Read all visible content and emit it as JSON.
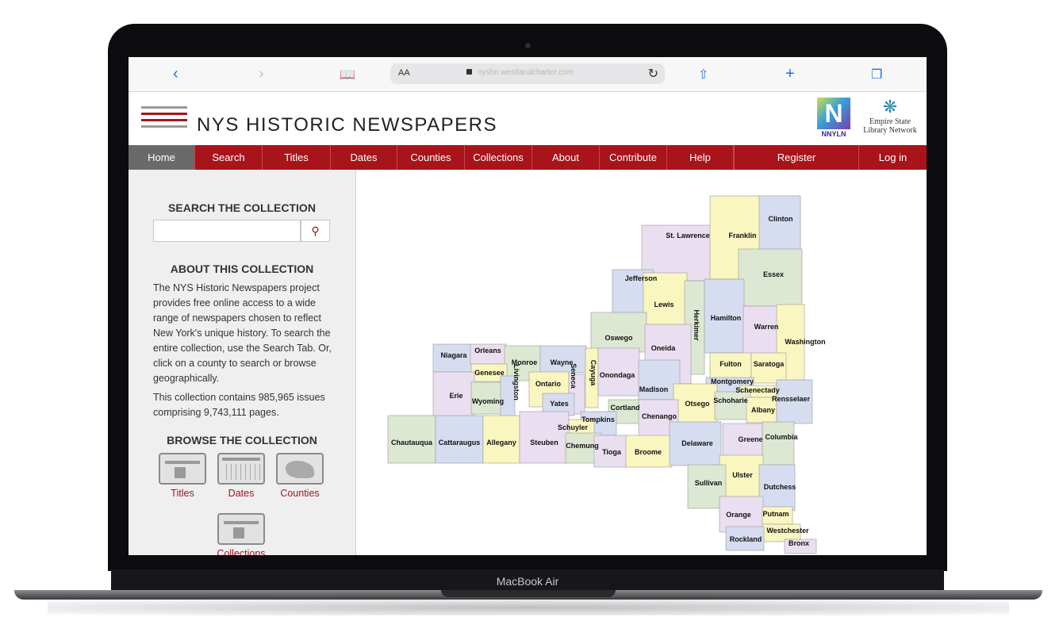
{
  "device": {
    "brand": "MacBook Air"
  },
  "browser": {
    "url_size_label": "AA",
    "url_text": "nyshn.westlandcharter.com"
  },
  "site": {
    "title": "NYS HISTORIC NEWSPAPERS"
  },
  "partners": {
    "nnyln_label": "NNYLN",
    "esln_line1": "Empire State",
    "esln_line2": "Library Network"
  },
  "nav": {
    "items": [
      "Home",
      "Search",
      "Titles",
      "Dates",
      "Counties",
      "Collections",
      "About",
      "Contribute",
      "Help"
    ],
    "register": "Register",
    "login": "Log in"
  },
  "sidebar": {
    "search_heading": "SEARCH THE COLLECTION",
    "search_value": "",
    "about_heading": "ABOUT THIS COLLECTION",
    "about_text": "The NYS Historic Newspapers project provides free online access to a wide range of newspapers chosen to reflect New York's unique history. To search the entire collection, use the Search Tab. Or, click on a county to search or browse geographically.",
    "stats_text": "This collection contains 985,965 issues comprising 9,743,111 pages.",
    "browse_heading": "BROWSE THE COLLECTION",
    "browse_items": [
      "Titles",
      "Dates",
      "Counties",
      "Collections"
    ]
  },
  "map": {
    "counties": [
      "Clinton",
      "St. Lawrence",
      "Franklin",
      "Essex",
      "Jefferson",
      "Lewis",
      "Herkimer",
      "Hamilton",
      "Warren",
      "Washington",
      "Oswego",
      "Oneida",
      "Niagara",
      "Orleans",
      "Monroe",
      "Wayne",
      "Genesee",
      "Cayuga",
      "Onondaga",
      "Fulton",
      "Saratoga",
      "Montgomery",
      "Schenectady",
      "Ontario",
      "Erie",
      "Wyoming",
      "Livingston",
      "Seneca",
      "Madison",
      "Yates",
      "Otsego",
      "Schoharie",
      "Albany",
      "Rensselaer",
      "Cortland",
      "Tompkins",
      "Chenango",
      "Schuyler",
      "Chautauqua",
      "Cattaraugus",
      "Allegany",
      "Steuben",
      "Chemung",
      "Tioga",
      "Broome",
      "Delaware",
      "Greene",
      "Columbia",
      "Ulster",
      "Sullivan",
      "Dutchess",
      "Orange",
      "Putnam",
      "Westchester",
      "Rockland",
      "Bronx"
    ],
    "fill_colors": [
      "#d6ddf0",
      "#eadff0",
      "#faf6c0",
      "#dde8d2"
    ]
  }
}
